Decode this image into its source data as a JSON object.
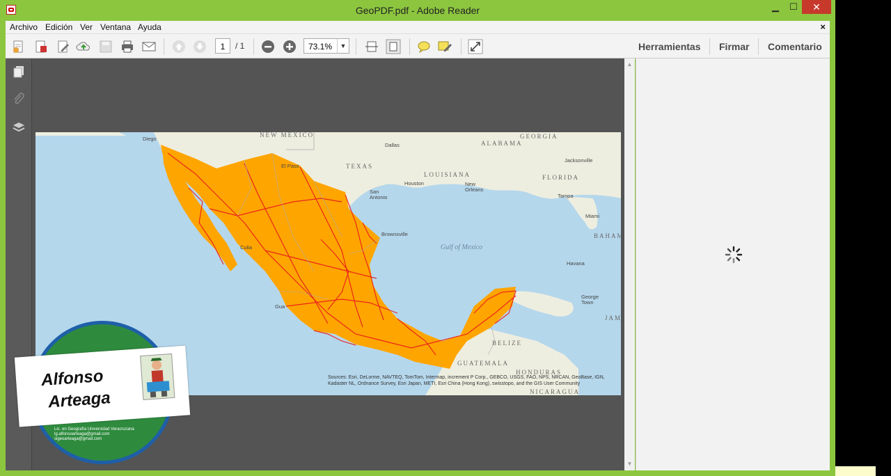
{
  "window": {
    "title": "GeoPDF.pdf - Adobe Reader",
    "min": "▁",
    "max": "☐",
    "close": "✕"
  },
  "menu": {
    "items": [
      "Archivo",
      "Edición",
      "Ver",
      "Ventana",
      "Ayuda"
    ],
    "close": "×"
  },
  "toolbar": {
    "page_current": "1",
    "page_total": "/ 1",
    "zoom": "73.1%",
    "zoom_arrow": "▼"
  },
  "right_tabs": [
    "Herramientas",
    "Firmar",
    "Comentario"
  ],
  "scroll": {
    "up": "▲",
    "down": "▼"
  },
  "map": {
    "labels": {
      "new_mexico": "NEW MEXICO",
      "texas": "TEXAS",
      "alabama": "ALABAMA",
      "georgia": "GEORGIA",
      "louisiana": "LOUISIANA",
      "florida": "FLORIDA",
      "gulf": "Gulf of Mexico",
      "belize": "BELIZE",
      "guatemala": "GUATEMALA",
      "honduras": "HONDURAS",
      "nicaragua": "NICARAGUA",
      "bahamas": "BAHAM",
      "jamaica": "JAMA"
    },
    "cities": {
      "dallas": "Dallas",
      "el_paso": "El Paso",
      "houston": "Houston",
      "san_antonio": "San Antonio",
      "new_orleans": "New Orleans",
      "jacksonville": "Jacksonville",
      "tampa": "Tampa",
      "miami": "Miami",
      "havana": "Havana",
      "brownsville": "Brownsville",
      "culiacan": "Culia",
      "guadalajara": "Gua",
      "diego": "Diego",
      "george_town": "George Town"
    },
    "attribution": "Sources: Esri, DeLorme, NAVTEQ, TomTom, Intermap, increment P Corp., GEBCO, USGS, FAO, NPS, NRCAN, GeoBase, IGN, Kadaster NL, Ordnance Survey, Esri Japan, METI, Esri China (Hong Kong), swisstopo, and the GIS User Community"
  },
  "watermark": {
    "name_first": "Alfonso",
    "name_last": "Arteaga",
    "info": [
      "Lic. en Geografía Universidad Veracruzana",
      "lg.alfonsoarteaga@gmail.com",
      "sigeoarteaga@gmail.com"
    ]
  },
  "colors": {
    "mexico_fill": "#ffa500",
    "roads": "#e8191c",
    "ocean": "#b5d7ec",
    "land": "#eeeee0",
    "window_accent": "#8cc63f"
  }
}
